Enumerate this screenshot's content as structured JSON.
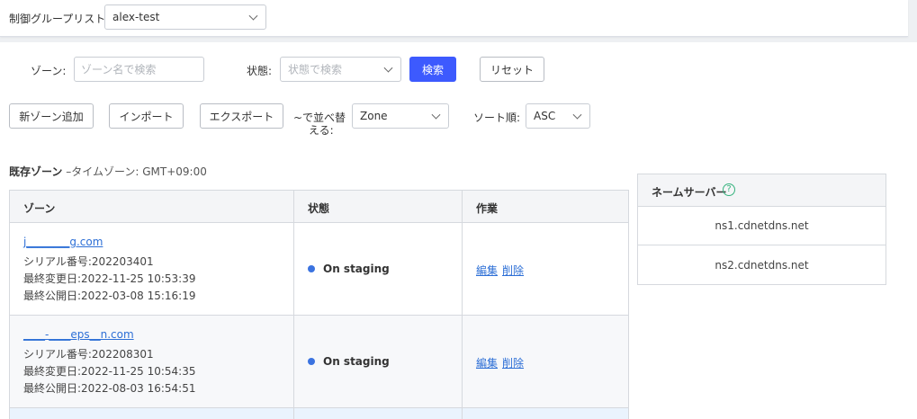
{
  "control_group": {
    "label": "制御グループリスト",
    "value": "alex-test"
  },
  "filters": {
    "zone_label": "ゾーン:",
    "zone_placeholder": "ゾーン名で検索",
    "status_label": "状態:",
    "status_placeholder": "状態で検索",
    "search_button": "検索",
    "reset_button": "リセット"
  },
  "toolbar": {
    "add_zone": "新ゾーン追加",
    "import": "インポート",
    "export": "エクスポート",
    "sort_by_label_1": "~で並べ替",
    "sort_by_label_2": "える:",
    "sort_by_value": "Zone",
    "sort_order_label": "ソート順:",
    "sort_order_value": "ASC"
  },
  "existing_zones": {
    "title": "既存ゾーン",
    "subtitle": "–タイムゾーン: GMT+09:00"
  },
  "table": {
    "headers": {
      "zone": "ゾーン",
      "status": "状態",
      "actions": "作業"
    },
    "rows": [
      {
        "zone": "j________g.com",
        "serial": "シリアル番号:202203401",
        "modified": "最終変更日:2022-11-25 10:53:39",
        "published": "最終公開日:2022-03-08 15:16:19",
        "status": "On staging",
        "edit": "編集",
        "delete": "削除"
      },
      {
        "zone": "____-____eps__n.com",
        "serial": "シリアル番号:202208301",
        "modified": "最終変更日:2022-11-25 10:54:35",
        "published": "最終公開日:2022-08-03 16:54:51",
        "status": "On staging",
        "edit": "編集",
        "delete": "削除"
      }
    ]
  },
  "nameservers": {
    "title": "ネームサーバー",
    "help": "?",
    "items": [
      "ns1.cdnetdns.net",
      "ns2.cdnetdns.net"
    ]
  },
  "colors": {
    "primary": "#3d5afe",
    "status_dot": "#3b73e0",
    "link": "#2d6fd6",
    "help": "#36b37e"
  }
}
